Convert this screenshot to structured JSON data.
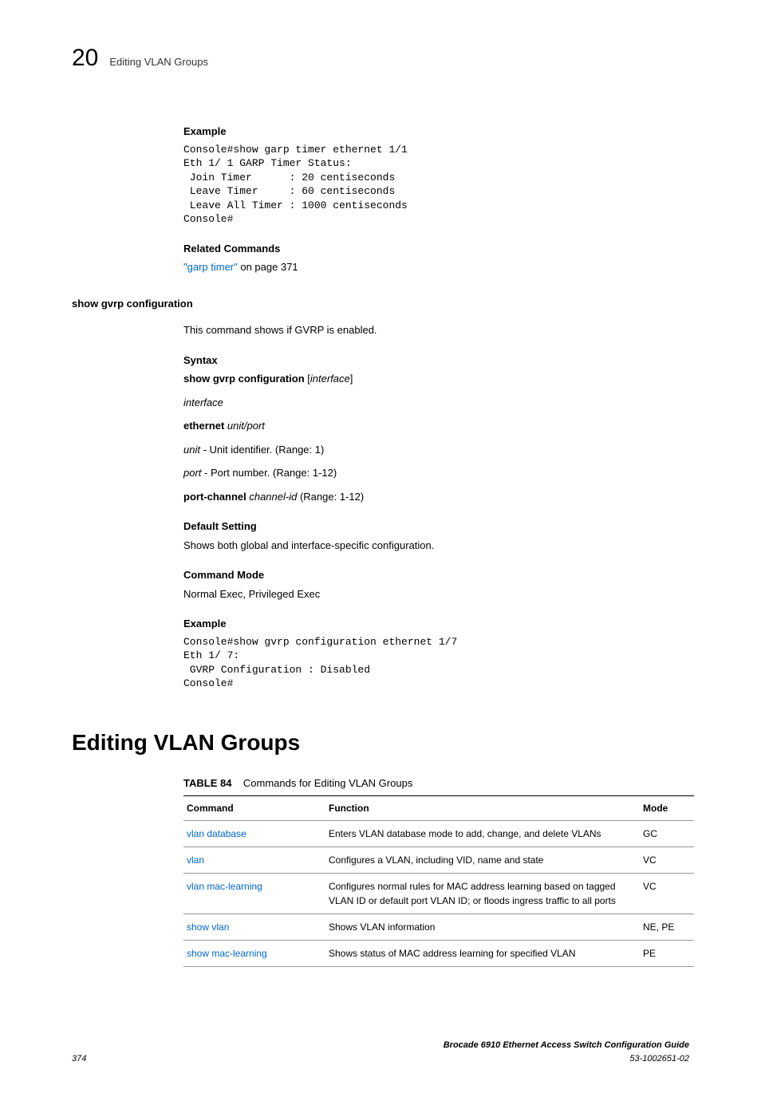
{
  "header": {
    "chapter_number": "20",
    "chapter_title": "Editing VLAN Groups"
  },
  "sections": {
    "example1": {
      "heading": "Example",
      "code": "Console#show garp timer ethernet 1/1\nEth 1/ 1 GARP Timer Status:\n Join Timer      : 20 centiseconds\n Leave Timer     : 60 centiseconds\n Leave All Timer : 1000 centiseconds\nConsole#"
    },
    "related": {
      "heading": "Related Commands",
      "link_text": "\"garp timer\"",
      "rest": " on page 371"
    },
    "command_name": "show gvrp configuration",
    "description": "This command shows if GVRP is enabled.",
    "syntax": {
      "heading": "Syntax",
      "line1_bold": "show gvrp configuration",
      "line1_rest": " [interface]",
      "interface": "interface",
      "ethernet_bold": "ethernet",
      "ethernet_rest": " unit/port",
      "unit_em": "unit",
      "unit_desc": " - Unit identifier. (Range: 1)",
      "port_em": "port",
      "port_desc": " - Port number. (Range: 1-12)",
      "pc_bold": "port-channel",
      "pc_em": " channel-id",
      "pc_desc": " (Range: 1-12)"
    },
    "default_setting": {
      "heading": "Default Setting",
      "text": "Shows both global and interface-specific configuration."
    },
    "command_mode": {
      "heading": "Command Mode",
      "text": "Normal Exec, Privileged Exec"
    },
    "example2": {
      "heading": "Example",
      "code": "Console#show gvrp configuration ethernet 1/7\nEth 1/ 7:\n GVRP Configuration : Disabled\nConsole#"
    }
  },
  "main_heading": "Editing VLAN Groups",
  "table": {
    "label": "TABLE 84",
    "caption": "Commands for Editing VLAN Groups",
    "headers": {
      "c1": "Command",
      "c2": "Function",
      "c3": "Mode"
    },
    "rows": [
      {
        "cmd": "vlan database",
        "func": "Enters VLAN database mode to add, change, and delete VLANs",
        "mode": "GC"
      },
      {
        "cmd": "vlan",
        "func": "Configures a VLAN, including VID, name and state",
        "mode": "VC"
      },
      {
        "cmd": "vlan mac-learning",
        "func": "Configures normal rules for MAC address learning based on tagged VLAN ID or default port VLAN ID; or  floods ingress traffic to all ports",
        "mode": "VC"
      },
      {
        "cmd": "show vlan",
        "func": "Shows VLAN information",
        "mode": "NE, PE"
      },
      {
        "cmd": "show mac-learning",
        "func": "Shows status of MAC address learning for specified VLAN",
        "mode": "PE"
      }
    ]
  },
  "footer": {
    "page": "374",
    "doc": "Brocade 6910 Ethernet Access Switch Configuration Guide",
    "docnum": "53-1002651-02"
  }
}
